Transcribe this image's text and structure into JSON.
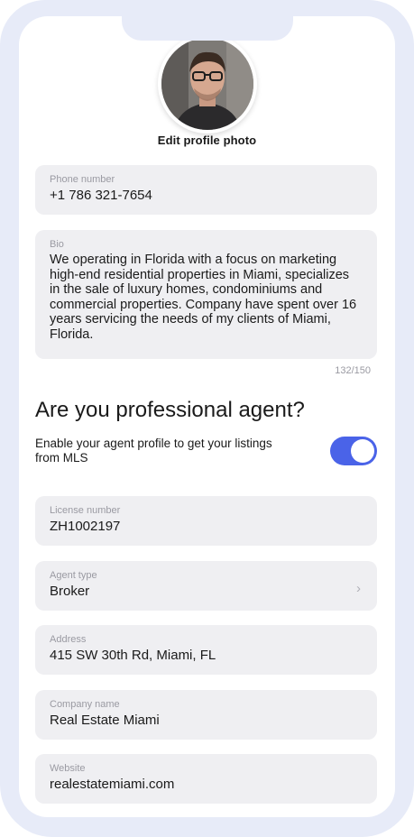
{
  "profile": {
    "edit_photo_label": "Edit profile photo"
  },
  "phone": {
    "label": "Phone number",
    "value": "+1 786 321-7654"
  },
  "bio": {
    "label": "Bio",
    "value": "We operating in Florida with a focus on marketing high-end residential properties in Miami, specializes in the sale of luxury homes, condominiums and commercial properties. Company have spent over 16 years servicing the needs of my clients of Miami, Florida.",
    "counter": "132/150"
  },
  "agent_section": {
    "heading": "Are you professional agent?",
    "toggle_text": "Enable your agent profile to get your listings from MLS",
    "toggle_on": true
  },
  "license": {
    "label": "License number",
    "value": "ZH1002197"
  },
  "agent_type": {
    "label": "Agent type",
    "value": "Broker",
    "chevron": "›"
  },
  "address": {
    "label": "Address",
    "value": "415 SW 30th Rd, Miami, FL"
  },
  "company": {
    "label": "Company name",
    "value": "Real Estate Miami"
  },
  "website": {
    "label": "Website",
    "value": "realestatemiami.com"
  },
  "colors": {
    "accent": "#4a63e8",
    "field_bg": "#efeff2",
    "frame": "#e7ebf8"
  }
}
